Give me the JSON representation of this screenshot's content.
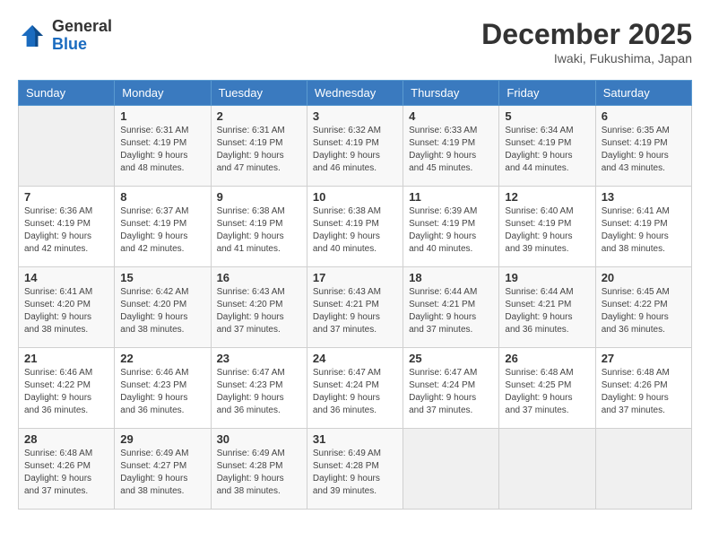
{
  "header": {
    "logo_general": "General",
    "logo_blue": "Blue",
    "month_title": "December 2025",
    "location": "Iwaki, Fukushima, Japan"
  },
  "weekdays": [
    "Sunday",
    "Monday",
    "Tuesday",
    "Wednesday",
    "Thursday",
    "Friday",
    "Saturday"
  ],
  "weeks": [
    [
      {
        "day": "",
        "info": ""
      },
      {
        "day": "1",
        "info": "Sunrise: 6:31 AM\nSunset: 4:19 PM\nDaylight: 9 hours\nand 48 minutes."
      },
      {
        "day": "2",
        "info": "Sunrise: 6:31 AM\nSunset: 4:19 PM\nDaylight: 9 hours\nand 47 minutes."
      },
      {
        "day": "3",
        "info": "Sunrise: 6:32 AM\nSunset: 4:19 PM\nDaylight: 9 hours\nand 46 minutes."
      },
      {
        "day": "4",
        "info": "Sunrise: 6:33 AM\nSunset: 4:19 PM\nDaylight: 9 hours\nand 45 minutes."
      },
      {
        "day": "5",
        "info": "Sunrise: 6:34 AM\nSunset: 4:19 PM\nDaylight: 9 hours\nand 44 minutes."
      },
      {
        "day": "6",
        "info": "Sunrise: 6:35 AM\nSunset: 4:19 PM\nDaylight: 9 hours\nand 43 minutes."
      }
    ],
    [
      {
        "day": "7",
        "info": "Sunrise: 6:36 AM\nSunset: 4:19 PM\nDaylight: 9 hours\nand 42 minutes."
      },
      {
        "day": "8",
        "info": "Sunrise: 6:37 AM\nSunset: 4:19 PM\nDaylight: 9 hours\nand 42 minutes."
      },
      {
        "day": "9",
        "info": "Sunrise: 6:38 AM\nSunset: 4:19 PM\nDaylight: 9 hours\nand 41 minutes."
      },
      {
        "day": "10",
        "info": "Sunrise: 6:38 AM\nSunset: 4:19 PM\nDaylight: 9 hours\nand 40 minutes."
      },
      {
        "day": "11",
        "info": "Sunrise: 6:39 AM\nSunset: 4:19 PM\nDaylight: 9 hours\nand 40 minutes."
      },
      {
        "day": "12",
        "info": "Sunrise: 6:40 AM\nSunset: 4:19 PM\nDaylight: 9 hours\nand 39 minutes."
      },
      {
        "day": "13",
        "info": "Sunrise: 6:41 AM\nSunset: 4:19 PM\nDaylight: 9 hours\nand 38 minutes."
      }
    ],
    [
      {
        "day": "14",
        "info": "Sunrise: 6:41 AM\nSunset: 4:20 PM\nDaylight: 9 hours\nand 38 minutes."
      },
      {
        "day": "15",
        "info": "Sunrise: 6:42 AM\nSunset: 4:20 PM\nDaylight: 9 hours\nand 38 minutes."
      },
      {
        "day": "16",
        "info": "Sunrise: 6:43 AM\nSunset: 4:20 PM\nDaylight: 9 hours\nand 37 minutes."
      },
      {
        "day": "17",
        "info": "Sunrise: 6:43 AM\nSunset: 4:21 PM\nDaylight: 9 hours\nand 37 minutes."
      },
      {
        "day": "18",
        "info": "Sunrise: 6:44 AM\nSunset: 4:21 PM\nDaylight: 9 hours\nand 37 minutes."
      },
      {
        "day": "19",
        "info": "Sunrise: 6:44 AM\nSunset: 4:21 PM\nDaylight: 9 hours\nand 36 minutes."
      },
      {
        "day": "20",
        "info": "Sunrise: 6:45 AM\nSunset: 4:22 PM\nDaylight: 9 hours\nand 36 minutes."
      }
    ],
    [
      {
        "day": "21",
        "info": "Sunrise: 6:46 AM\nSunset: 4:22 PM\nDaylight: 9 hours\nand 36 minutes."
      },
      {
        "day": "22",
        "info": "Sunrise: 6:46 AM\nSunset: 4:23 PM\nDaylight: 9 hours\nand 36 minutes."
      },
      {
        "day": "23",
        "info": "Sunrise: 6:47 AM\nSunset: 4:23 PM\nDaylight: 9 hours\nand 36 minutes."
      },
      {
        "day": "24",
        "info": "Sunrise: 6:47 AM\nSunset: 4:24 PM\nDaylight: 9 hours\nand 36 minutes."
      },
      {
        "day": "25",
        "info": "Sunrise: 6:47 AM\nSunset: 4:24 PM\nDaylight: 9 hours\nand 37 minutes."
      },
      {
        "day": "26",
        "info": "Sunrise: 6:48 AM\nSunset: 4:25 PM\nDaylight: 9 hours\nand 37 minutes."
      },
      {
        "day": "27",
        "info": "Sunrise: 6:48 AM\nSunset: 4:26 PM\nDaylight: 9 hours\nand 37 minutes."
      }
    ],
    [
      {
        "day": "28",
        "info": "Sunrise: 6:48 AM\nSunset: 4:26 PM\nDaylight: 9 hours\nand 37 minutes."
      },
      {
        "day": "29",
        "info": "Sunrise: 6:49 AM\nSunset: 4:27 PM\nDaylight: 9 hours\nand 38 minutes."
      },
      {
        "day": "30",
        "info": "Sunrise: 6:49 AM\nSunset: 4:28 PM\nDaylight: 9 hours\nand 38 minutes."
      },
      {
        "day": "31",
        "info": "Sunrise: 6:49 AM\nSunset: 4:28 PM\nDaylight: 9 hours\nand 39 minutes."
      },
      {
        "day": "",
        "info": ""
      },
      {
        "day": "",
        "info": ""
      },
      {
        "day": "",
        "info": ""
      }
    ]
  ]
}
